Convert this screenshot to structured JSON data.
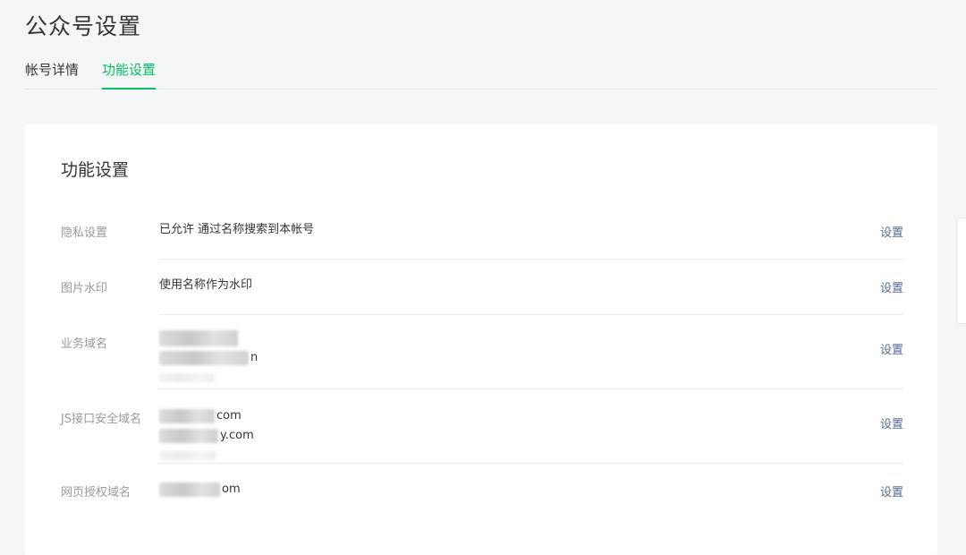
{
  "header": {
    "title": "公众号设置"
  },
  "tabs": [
    {
      "label": "帐号详情",
      "active": false
    },
    {
      "label": "功能设置",
      "active": true
    }
  ],
  "card": {
    "title": "功能设置",
    "rows": [
      {
        "label": "隐私设置",
        "value": "已允许 通过名称搜索到本帐号",
        "action": "设置"
      },
      {
        "label": "图片水印",
        "value": "使用名称作为水印",
        "action": "设置"
      },
      {
        "label": "业务域名",
        "domains": [
          "n"
        ],
        "action": "设置"
      },
      {
        "label": "JS接口安全域名",
        "domains": [
          "com",
          "y.com"
        ],
        "action": "设置"
      },
      {
        "label": "网页授权域名",
        "domains": [
          "om"
        ],
        "action": "设置"
      }
    ]
  },
  "colors": {
    "accent": "#07c160",
    "link": "#576b95",
    "label": "#9a9a9a",
    "background": "#f5f6f8"
  }
}
